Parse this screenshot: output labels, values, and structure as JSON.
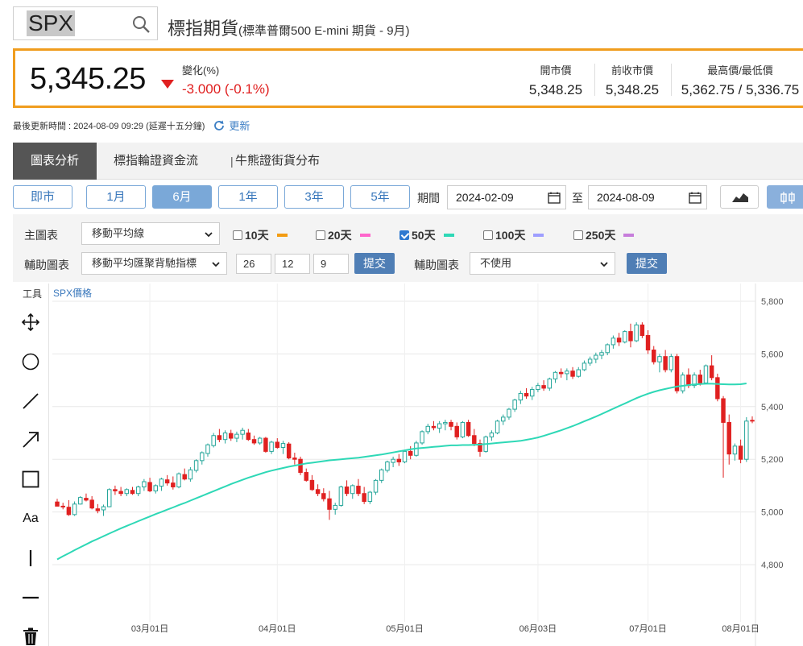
{
  "search": {
    "value": "SPX"
  },
  "product": {
    "title": "標指期貨",
    "subtitle": "(標準普爾500 E-mini 期貨 - 9月)"
  },
  "quote": {
    "price": "5,345.25",
    "change_label": "變化(%)",
    "change_value": "-3.000 (-0.1%)",
    "open_label": "開市價",
    "open_value": "5,348.25",
    "prev_label": "前收市價",
    "prev_value": "5,348.25",
    "hl_label": "最高價/最低價",
    "hl_value": "5,362.75 / 5,336.75",
    "up_color": "#26a69a",
    "down_color": "#e02020"
  },
  "update": {
    "text": "最後更新時間 : 2024-08-09 09:29 (延遲十五分鐘)",
    "refresh_label": "更新"
  },
  "tabs": [
    "圖表分析",
    "標指輪證資金流",
    "|",
    "牛熊證街貨分布"
  ],
  "ranges": {
    "items": [
      "即市",
      "1月",
      "6月",
      "1年",
      "3年",
      "5年"
    ],
    "active": "6月"
  },
  "period": {
    "label": "期間",
    "start": "2024-02-09",
    "to": "至",
    "end": "2024-08-09"
  },
  "settings": {
    "main_label": "主圖表",
    "main_select": "移動平均線",
    "ma": [
      {
        "label": "10天",
        "checked": false,
        "color": "#f39c12"
      },
      {
        "label": "20天",
        "checked": false,
        "color": "#ff66cc"
      },
      {
        "label": "50天",
        "checked": true,
        "color": "#2ed8b6"
      },
      {
        "label": "100天",
        "checked": false,
        "color": "#9e9eff"
      },
      {
        "label": "250天",
        "checked": false,
        "color": "#c77ddb"
      }
    ],
    "aux_label": "輔助圖表",
    "aux_select": "移動平均匯聚背馳指標",
    "macd_params": [
      "26",
      "12",
      "9"
    ],
    "submit": "提交",
    "aux2_label": "輔助圖表",
    "aux2_select": "不使用",
    "submit2": "提交"
  },
  "toolbar": {
    "title": "工具",
    "tools": [
      "move-icon",
      "circle-icon",
      "line-icon",
      "arrow-icon",
      "rectangle-icon",
      "text-tool",
      "vertical-line-icon",
      "horizontal-line-icon",
      "trash-icon"
    ],
    "text_tool_label": "Aa"
  },
  "chart_data": {
    "type": "candlestick",
    "title": "SPX價格",
    "ylim": [
      4700,
      5850
    ],
    "y_ticks": [
      "5,800",
      "5,600",
      "5,400",
      "5,200",
      "5,000",
      "4,800"
    ],
    "x_ticks": [
      "03月01日",
      "04月01日",
      "05月01日",
      "06月03日",
      "07月01日",
      "08月01日"
    ],
    "grid": true,
    "candles": [
      [
        5038,
        5050,
        5025,
        5022
      ],
      [
        5022,
        5035,
        5010,
        5020
      ],
      [
        5018,
        5045,
        4985,
        4990
      ],
      [
        4990,
        5040,
        4985,
        5030
      ],
      [
        5030,
        5060,
        5028,
        5055
      ],
      [
        5052,
        5070,
        5040,
        5045
      ],
      [
        5045,
        5060,
        5010,
        5015
      ],
      [
        5012,
        5030,
        4995,
        5005
      ],
      [
        5008,
        5028,
        4985,
        5020
      ],
      [
        5020,
        5090,
        5018,
        5085
      ],
      [
        5085,
        5100,
        5065,
        5080
      ],
      [
        5078,
        5095,
        5060,
        5070
      ],
      [
        5070,
        5090,
        5060,
        5085
      ],
      [
        5082,
        5095,
        5065,
        5070
      ],
      [
        5070,
        5100,
        5060,
        5095
      ],
      [
        5095,
        5125,
        5080,
        5115
      ],
      [
        5112,
        5130,
        5075,
        5080
      ],
      [
        5080,
        5105,
        5070,
        5100
      ],
      [
        5098,
        5130,
        5080,
        5125
      ],
      [
        5122,
        5140,
        5100,
        5110
      ],
      [
        5110,
        5135,
        5085,
        5095
      ],
      [
        5095,
        5150,
        5090,
        5145
      ],
      [
        5142,
        5165,
        5120,
        5125
      ],
      [
        5125,
        5170,
        5115,
        5160
      ],
      [
        5158,
        5200,
        5150,
        5195
      ],
      [
        5195,
        5230,
        5180,
        5225
      ],
      [
        5222,
        5260,
        5210,
        5255
      ],
      [
        5252,
        5300,
        5245,
        5290
      ],
      [
        5290,
        5315,
        5265,
        5275
      ],
      [
        5275,
        5310,
        5260,
        5300
      ],
      [
        5298,
        5312,
        5270,
        5280
      ],
      [
        5280,
        5305,
        5265,
        5295
      ],
      [
        5295,
        5320,
        5275,
        5310
      ],
      [
        5300,
        5315,
        5270,
        5275
      ],
      [
        5275,
        5290,
        5255,
        5262
      ],
      [
        5262,
        5285,
        5255,
        5280
      ],
      [
        5280,
        5285,
        5225,
        5230
      ],
      [
        5230,
        5270,
        5220,
        5265
      ],
      [
        5265,
        5280,
        5240,
        5245
      ],
      [
        5245,
        5270,
        5220,
        5260
      ],
      [
        5258,
        5265,
        5200,
        5205
      ],
      [
        5205,
        5225,
        5180,
        5200
      ],
      [
        5200,
        5210,
        5140,
        5150
      ],
      [
        5150,
        5165,
        5115,
        5120
      ],
      [
        5120,
        5140,
        5080,
        5085
      ],
      [
        5085,
        5105,
        5060,
        5070
      ],
      [
        5070,
        5090,
        5040,
        5050
      ],
      [
        5050,
        5080,
        4970,
        5010
      ],
      [
        5010,
        5035,
        4990,
        5025
      ],
      [
        5025,
        5100,
        5020,
        5095
      ],
      [
        5095,
        5120,
        5060,
        5070
      ],
      [
        5070,
        5105,
        5050,
        5100
      ],
      [
        5098,
        5125,
        5060,
        5070
      ],
      [
        5070,
        5095,
        5030,
        5040
      ],
      [
        5040,
        5080,
        5030,
        5075
      ],
      [
        5075,
        5125,
        5065,
        5120
      ],
      [
        5120,
        5165,
        5110,
        5160
      ],
      [
        5158,
        5195,
        5150,
        5190
      ],
      [
        5188,
        5210,
        5170,
        5200
      ],
      [
        5200,
        5220,
        5175,
        5190
      ],
      [
        5190,
        5235,
        5185,
        5230
      ],
      [
        5230,
        5250,
        5200,
        5215
      ],
      [
        5215,
        5270,
        5210,
        5262
      ],
      [
        5262,
        5310,
        5255,
        5305
      ],
      [
        5305,
        5335,
        5295,
        5325
      ],
      [
        5325,
        5345,
        5310,
        5320
      ],
      [
        5318,
        5345,
        5300,
        5335
      ],
      [
        5335,
        5350,
        5310,
        5340
      ],
      [
        5340,
        5350,
        5310,
        5325
      ],
      [
        5325,
        5340,
        5275,
        5285
      ],
      [
        5285,
        5345,
        5280,
        5340
      ],
      [
        5340,
        5350,
        5285,
        5290
      ],
      [
        5290,
        5315,
        5250,
        5260
      ],
      [
        5260,
        5275,
        5210,
        5230
      ],
      [
        5230,
        5290,
        5225,
        5285
      ],
      [
        5285,
        5310,
        5270,
        5300
      ],
      [
        5300,
        5350,
        5295,
        5345
      ],
      [
        5345,
        5370,
        5330,
        5360
      ],
      [
        5360,
        5395,
        5350,
        5390
      ],
      [
        5390,
        5430,
        5380,
        5425
      ],
      [
        5425,
        5460,
        5410,
        5450
      ],
      [
        5450,
        5470,
        5430,
        5440
      ],
      [
        5440,
        5475,
        5425,
        5465
      ],
      [
        5465,
        5490,
        5455,
        5480
      ],
      [
        5480,
        5500,
        5460,
        5470
      ],
      [
        5470,
        5510,
        5460,
        5505
      ],
      [
        5505,
        5535,
        5490,
        5530
      ],
      [
        5530,
        5545,
        5510,
        5525
      ],
      [
        5525,
        5545,
        5500,
        5535
      ],
      [
        5535,
        5550,
        5505,
        5515
      ],
      [
        5515,
        5550,
        5510,
        5540
      ],
      [
        5540,
        5575,
        5535,
        5565
      ],
      [
        5565,
        5590,
        5555,
        5580
      ],
      [
        5580,
        5605,
        5565,
        5595
      ],
      [
        5595,
        5615,
        5580,
        5605
      ],
      [
        5605,
        5640,
        5595,
        5635
      ],
      [
        5635,
        5670,
        5620,
        5660
      ],
      [
        5660,
        5680,
        5630,
        5645
      ],
      [
        5645,
        5690,
        5640,
        5685
      ],
      [
        5685,
        5715,
        5625,
        5650
      ],
      [
        5650,
        5720,
        5645,
        5710
      ],
      [
        5710,
        5720,
        5660,
        5670
      ],
      [
        5670,
        5690,
        5600,
        5615
      ],
      [
        5615,
        5630,
        5560,
        5570
      ],
      [
        5570,
        5600,
        5530,
        5590
      ],
      [
        5590,
        5615,
        5530,
        5540
      ],
      [
        5540,
        5600,
        5530,
        5590
      ],
      [
        5590,
        5600,
        5450,
        5460
      ],
      [
        5460,
        5530,
        5450,
        5520
      ],
      [
        5520,
        5545,
        5470,
        5480
      ],
      [
        5480,
        5530,
        5470,
        5520
      ],
      [
        5520,
        5540,
        5480,
        5490
      ],
      [
        5490,
        5560,
        5485,
        5555
      ],
      [
        5555,
        5595,
        5500,
        5510
      ],
      [
        5510,
        5525,
        5420,
        5430
      ],
      [
        5430,
        5440,
        5130,
        5340
      ],
      [
        5340,
        5370,
        5180,
        5220
      ],
      [
        5220,
        5260,
        5195,
        5250
      ],
      [
        5250,
        5275,
        5185,
        5200
      ],
      [
        5200,
        5360,
        5190,
        5345
      ],
      [
        5348,
        5363,
        5337,
        5345
      ]
    ],
    "sma50": [
      4820,
      4832,
      4843,
      4855,
      4866,
      4877,
      4888,
      4898,
      4908,
      4918,
      4928,
      4938,
      4947,
      4956,
      4965,
      4974,
      4983,
      4992,
      5000,
      5009,
      5017,
      5026,
      5034,
      5043,
      5052,
      5061,
      5070,
      5079,
      5088,
      5097,
      5106,
      5114,
      5122,
      5130,
      5137,
      5144,
      5151,
      5157,
      5162,
      5167,
      5172,
      5176,
      5180,
      5184,
      5187,
      5190,
      5193,
      5196,
      5198,
      5200,
      5202,
      5204,
      5206,
      5209,
      5212,
      5215,
      5218,
      5222,
      5226,
      5230,
      5234,
      5238,
      5241,
      5243,
      5245,
      5247,
      5249,
      5251,
      5253,
      5253,
      5254,
      5254,
      5255,
      5256,
      5258,
      5260,
      5262,
      5264,
      5266,
      5268,
      5270,
      5274,
      5278,
      5283,
      5289,
      5296,
      5303,
      5310,
      5318,
      5326,
      5335,
      5344,
      5353,
      5362,
      5372,
      5382,
      5392,
      5402,
      5412,
      5422,
      5432,
      5441,
      5449,
      5456,
      5462,
      5467,
      5472,
      5476,
      5479,
      5482,
      5484,
      5486,
      5487,
      5487,
      5486,
      5485,
      5484,
      5484,
      5485,
      5488
    ]
  }
}
